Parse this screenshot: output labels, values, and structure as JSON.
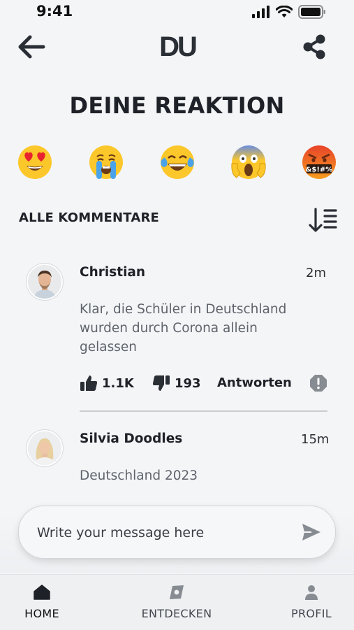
{
  "status_bar": {
    "time": "9:41"
  },
  "header": {
    "logo": "DU"
  },
  "reaction": {
    "title": "DEINE REAKTION",
    "emojis": [
      "heart-eyes-emoji",
      "crying-emoji",
      "tears-of-joy-emoji",
      "screaming-emoji",
      "cursing-emoji"
    ],
    "cursing_text": "&$!#%"
  },
  "comments_section": {
    "title": "ALLE KOMMENTARE"
  },
  "comments": [
    {
      "author": "Christian",
      "time": "2m",
      "lines": [
        "Klar, die Schüler in Deutschland",
        "wurden durch Corona allein",
        "gelassen"
      ],
      "likes": "1.1K",
      "dislikes": "193",
      "reply_label": "Antworten"
    },
    {
      "author": "Silvia Doodles",
      "time": "15m",
      "lines": [
        "Deutschland 2023"
      ]
    }
  ],
  "composer": {
    "placeholder": "Write your message here"
  },
  "tabbar": {
    "items": [
      {
        "label": "HOME",
        "active": true
      },
      {
        "label": "ENTDECKEN",
        "active": false
      },
      {
        "label": "PROFIL",
        "active": false
      }
    ]
  },
  "colors": {
    "background": "#f4f5f7",
    "text": "#1e2127",
    "muted": "#5f646c",
    "emoji_yellow": "#fcc72a"
  }
}
